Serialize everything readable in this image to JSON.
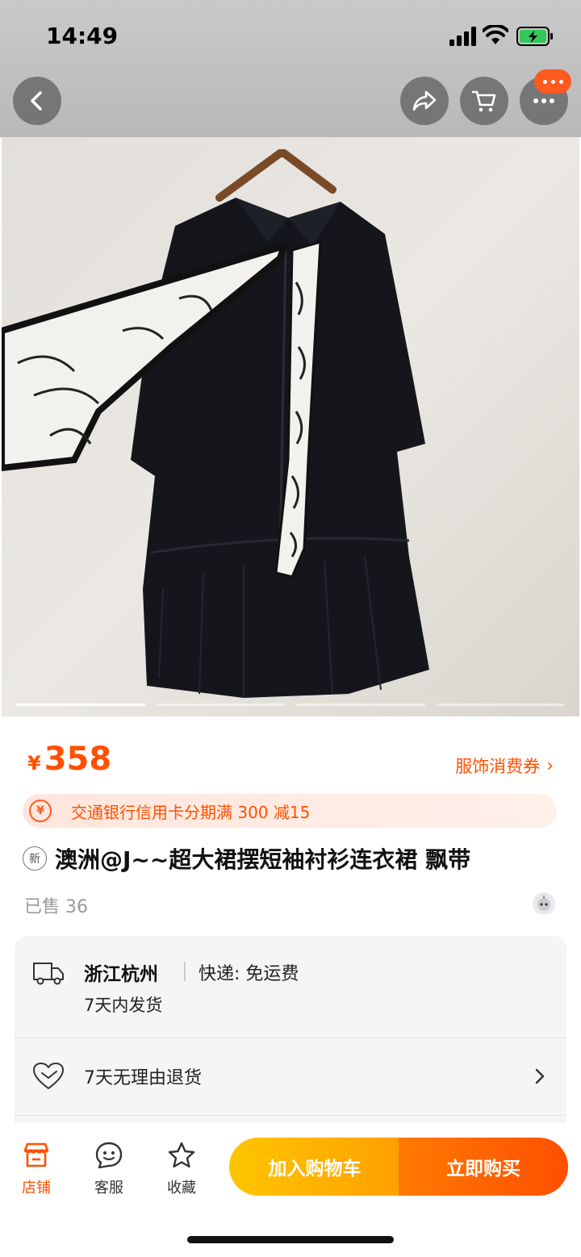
{
  "status_bar": {
    "time": "14:49"
  },
  "nav": {
    "back_icon": "chevron-left-icon",
    "share_icon": "share-arrow-icon",
    "cart_icon": "cart-icon",
    "more_icon": "more-dots-icon"
  },
  "gallery": {
    "image_count": 4,
    "active_index": 0
  },
  "product": {
    "currency": "¥",
    "price": "358",
    "coupon_link": "服饰消费券",
    "promo_text": "交通银行信用卡分期满 300 减15",
    "new_badge": "新",
    "title": "澳洲@J~~超大裙摆短袖衬衫连衣裙 飘带",
    "sold": "已售 36"
  },
  "shipping": {
    "location": "浙江杭州",
    "delivery": "快递: 免运费",
    "dispatch": "7天内发货"
  },
  "returns": {
    "text": "7天无理由退货"
  },
  "bottom_bar": {
    "shop_label": "店铺",
    "service_label": "客服",
    "favorite_label": "收藏",
    "add_to_cart": "加入购物车",
    "buy_now": "立即购买"
  },
  "colors": {
    "accent": "#ff5000",
    "cart_button": "#ffb000",
    "buy_button": "#ff5a00"
  }
}
